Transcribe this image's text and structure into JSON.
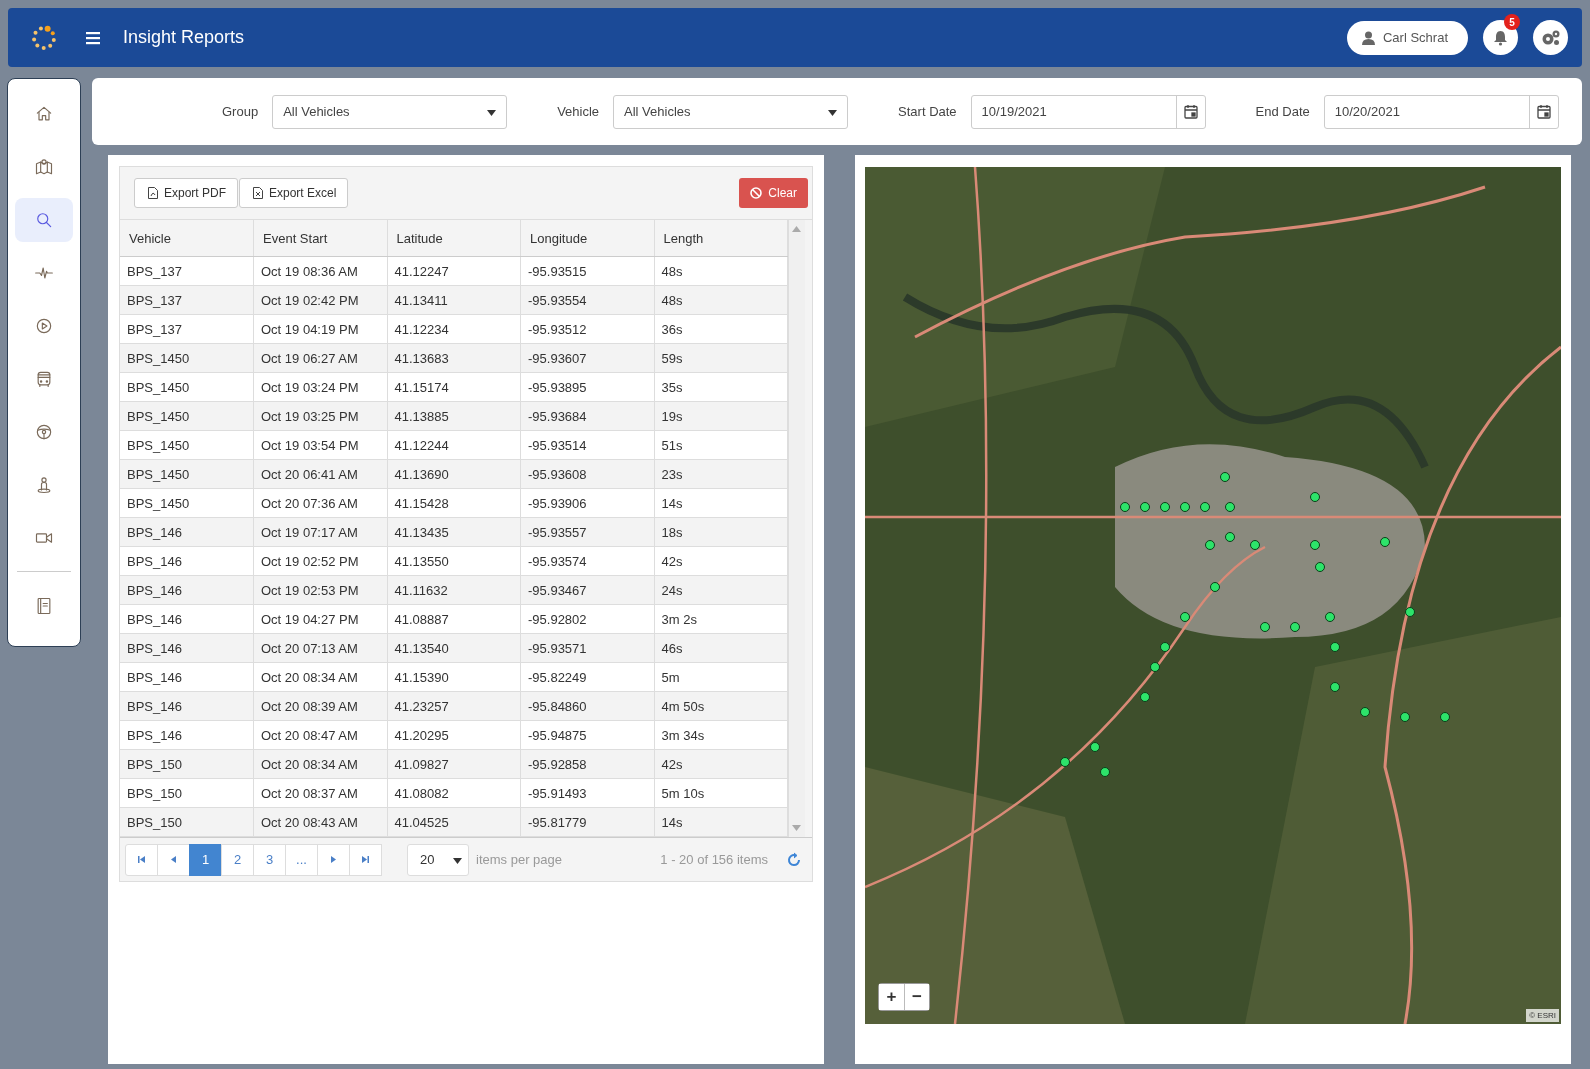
{
  "header": {
    "title": "Insight Reports",
    "user": "Carl Schrat",
    "notifications": "5"
  },
  "sidebar": {
    "items": [
      {
        "kind": "home",
        "selected": false
      },
      {
        "kind": "map",
        "selected": false
      },
      {
        "kind": "search",
        "selected": true
      },
      {
        "kind": "pulse",
        "selected": false
      },
      {
        "kind": "play",
        "selected": false
      },
      {
        "kind": "bus",
        "selected": false
      },
      {
        "kind": "wheel",
        "selected": false
      },
      {
        "kind": "person",
        "selected": false
      },
      {
        "kind": "video",
        "selected": false
      },
      {
        "kind": "book",
        "selected": false
      }
    ]
  },
  "filters": [
    {
      "kind": "select",
      "label": "Group",
      "value": "All Vehicles"
    },
    {
      "kind": "select",
      "label": "Vehicle",
      "value": "All Vehicles"
    },
    {
      "kind": "date",
      "label": "Start Date",
      "value": "10/19/2021"
    },
    {
      "kind": "date",
      "label": "End Date",
      "value": "10/20/2021"
    }
  ],
  "toolbar": {
    "export_buttons": [
      {
        "kind": "pdf",
        "label": "Export PDF"
      },
      {
        "kind": "excel",
        "label": "Export Excel"
      }
    ],
    "clear_button": "Clear"
  },
  "table": {
    "columns": [
      "Vehicle",
      "Event Start",
      "Latitude",
      "Longitude",
      "Length"
    ],
    "rows": [
      [
        "BPS_137",
        "Oct 19 08:36 AM",
        "41.12247",
        "-95.93515",
        "48s"
      ],
      [
        "BPS_137",
        "Oct 19 02:42 PM",
        "41.13411",
        "-95.93554",
        "48s"
      ],
      [
        "BPS_137",
        "Oct 19 04:19 PM",
        "41.12234",
        "-95.93512",
        "36s"
      ],
      [
        "BPS_1450",
        "Oct 19 06:27 AM",
        "41.13683",
        "-95.93607",
        "59s"
      ],
      [
        "BPS_1450",
        "Oct 19 03:24 PM",
        "41.15174",
        "-95.93895",
        "35s"
      ],
      [
        "BPS_1450",
        "Oct 19 03:25 PM",
        "41.13885",
        "-95.93684",
        "19s"
      ],
      [
        "BPS_1450",
        "Oct 19 03:54 PM",
        "41.12244",
        "-95.93514",
        "51s"
      ],
      [
        "BPS_1450",
        "Oct 20 06:41 AM",
        "41.13690",
        "-95.93608",
        "23s"
      ],
      [
        "BPS_1450",
        "Oct 20 07:36 AM",
        "41.15428",
        "-95.93906",
        "14s"
      ],
      [
        "BPS_146",
        "Oct 19 07:17 AM",
        "41.13435",
        "-95.93557",
        "18s"
      ],
      [
        "BPS_146",
        "Oct 19 02:52 PM",
        "41.13550",
        "-95.93574",
        "42s"
      ],
      [
        "BPS_146",
        "Oct 19 02:53 PM",
        "41.11632",
        "-95.93467",
        "24s"
      ],
      [
        "BPS_146",
        "Oct 19 04:27 PM",
        "41.08887",
        "-95.92802",
        "3m 2s"
      ],
      [
        "BPS_146",
        "Oct 20 07:13 AM",
        "41.13540",
        "-95.93571",
        "46s"
      ],
      [
        "BPS_146",
        "Oct 20 08:34 AM",
        "41.15390",
        "-95.82249",
        "5m"
      ],
      [
        "BPS_146",
        "Oct 20 08:39 AM",
        "41.23257",
        "-95.84860",
        "4m 50s"
      ],
      [
        "BPS_146",
        "Oct 20 08:47 AM",
        "41.20295",
        "-95.94875",
        "3m 34s"
      ],
      [
        "BPS_150",
        "Oct 20 08:34 AM",
        "41.09827",
        "-95.92858",
        "42s"
      ],
      [
        "BPS_150",
        "Oct 20 08:37 AM",
        "41.08082",
        "-95.91493",
        "5m 10s"
      ],
      [
        "BPS_150",
        "Oct 20 08:43 AM",
        "41.04525",
        "-95.81779",
        "14s"
      ]
    ]
  },
  "pager": {
    "pages": [
      {
        "label": "1",
        "selected": true
      },
      {
        "label": "2",
        "selected": false
      },
      {
        "label": "3",
        "selected": false
      },
      {
        "label": "...",
        "selected": false
      }
    ],
    "page_size": "20",
    "page_size_label": "items per page",
    "summary": "1 - 20 of 156 items"
  },
  "map": {
    "kind": "picture",
    "zoom_in": "+",
    "zoom_out": "−",
    "attribution": "© ESRI"
  }
}
